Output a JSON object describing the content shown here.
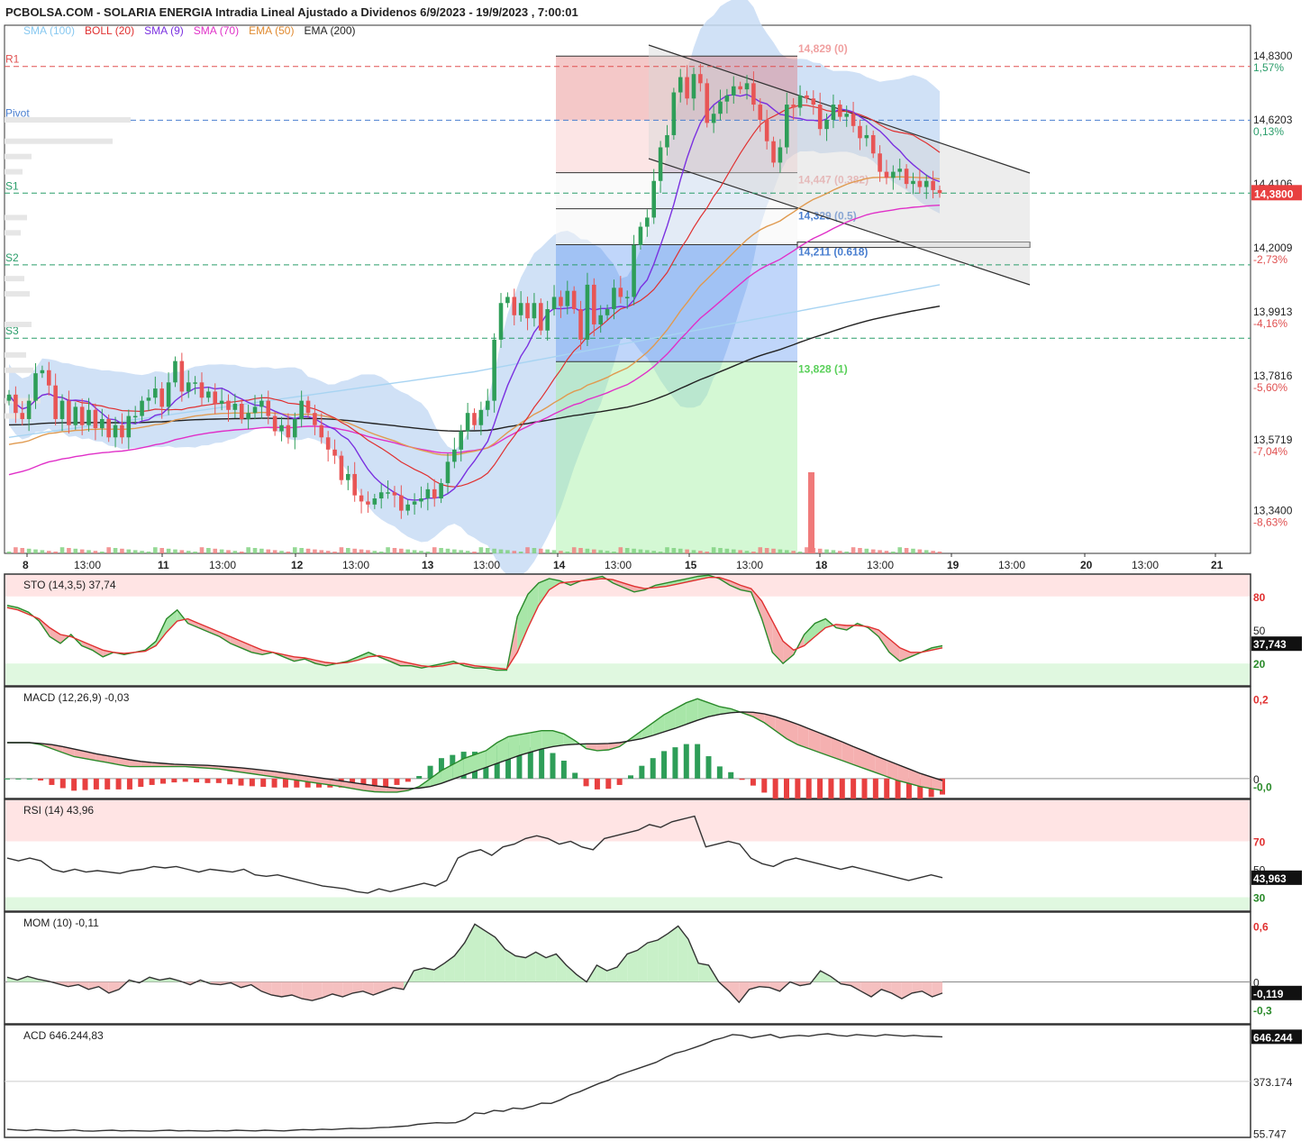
{
  "header": {
    "title": "PCBOLSA.COM - SOLARIA ENERGIA Intradia Lineal Ajustado a Dividenos 6/9/2023 - 19/9/2023 , 7:00:01",
    "legend": [
      {
        "label": "SMA",
        "param": "(100)",
        "color": "#87c8f0"
      },
      {
        "label": "BOLL",
        "param": "(20)",
        "color": "#e03030"
      },
      {
        "label": "SMA",
        "param": "(9)",
        "color": "#7a30e0"
      },
      {
        "label": "SMA",
        "param": "(70)",
        "color": "#e030c8"
      },
      {
        "label": "EMA",
        "param": "(50)",
        "color": "#e08a30"
      },
      {
        "label": "EMA",
        "param": "(200)",
        "color": "#222222"
      }
    ]
  },
  "chart_data": [
    {
      "type": "candlestick",
      "name": "price",
      "y_ticks": [
        {
          "v": 14.83,
          "label": "14,8300",
          "pct": "1,57%",
          "pct_color": "#2a9d6a"
        },
        {
          "v": 14.6203,
          "label": "14,6203",
          "pct": "0,13%",
          "pct_color": "#2a9d6a"
        },
        {
          "v": 14.4106,
          "label": "14,4106",
          "pct": "",
          "pct_color": ""
        },
        {
          "v": 14.2009,
          "label": "14,2009",
          "pct": "-2,73%",
          "pct_color": "#e05050"
        },
        {
          "v": 13.9913,
          "label": "13,9913",
          "pct": "-4,16%",
          "pct_color": "#e05050"
        },
        {
          "v": 13.7816,
          "label": "13,7816",
          "pct": "-5,60%",
          "pct_color": "#e05050"
        },
        {
          "v": 13.5719,
          "label": "13,5719",
          "pct": "-7,04%",
          "pct_color": "#e05050"
        },
        {
          "v": 13.34,
          "label": "13,3400",
          "pct": "-8,63%",
          "pct_color": "#e05050"
        }
      ],
      "last_price": "14,3800",
      "ylim": [
        13.2,
        14.93
      ],
      "pivots": [
        {
          "name": "R1",
          "v": 14.795,
          "color": "#e05050"
        },
        {
          "name": "Pivot",
          "v": 14.619,
          "color": "#4a7fd0"
        },
        {
          "name": "S1",
          "v": 14.38,
          "color": "#2a9d6a"
        },
        {
          "name": "S2",
          "v": 14.145,
          "color": "#2a9d6a"
        },
        {
          "name": "S3",
          "v": 13.905,
          "color": "#2a9d6a"
        }
      ],
      "fibonacci": [
        {
          "label": "14,829 (0)",
          "v": 14.829,
          "color": "#f0a0a0"
        },
        {
          "label": "14,447 (0.382)",
          "v": 14.447,
          "color": "#f0a0a0"
        },
        {
          "label": "14,329 (0.5)",
          "v": 14.329,
          "color": "#4a7fd0"
        },
        {
          "label": "14,211 (0.618)",
          "v": 14.211,
          "color": "#4a7fd0"
        },
        {
          "label": "13,828 (1)",
          "v": 13.828,
          "color": "#5ad05a"
        }
      ],
      "x_labels": [
        {
          "day": "8",
          "hour": "13:00"
        },
        {
          "day": "11",
          "hour": "13:00"
        },
        {
          "day": "12",
          "hour": "13:00"
        },
        {
          "day": "13",
          "hour": "13:00"
        },
        {
          "day": "14",
          "hour": "13:00"
        },
        {
          "day": "15",
          "hour": "13:00"
        },
        {
          "day": "18",
          "hour": "13:00"
        },
        {
          "day": "19",
          "hour": "13:00"
        },
        {
          "day": "20",
          "hour": "13:00"
        },
        {
          "day": "21",
          "hour": ""
        }
      ],
      "close": [
        13.72,
        13.66,
        13.64,
        13.7,
        13.79,
        13.8,
        13.75,
        13.64,
        13.7,
        13.62,
        13.68,
        13.62,
        13.67,
        13.61,
        13.64,
        13.58,
        13.62,
        13.58,
        13.65,
        13.65,
        13.7,
        13.71,
        13.74,
        13.68,
        13.76,
        13.83,
        13.73,
        13.76,
        13.76,
        13.71,
        13.73,
        13.69,
        13.7,
        13.67,
        13.69,
        13.64,
        13.66,
        13.68,
        13.7,
        13.65,
        13.6,
        13.62,
        13.58,
        13.64,
        13.7,
        13.66,
        13.62,
        13.58,
        13.54,
        13.52,
        13.44,
        13.46,
        13.39,
        13.37,
        13.36,
        13.38,
        13.4,
        13.4,
        13.39,
        13.34,
        13.36,
        13.37,
        13.38,
        13.41,
        13.38,
        13.43,
        13.5,
        13.54,
        13.6,
        13.66,
        13.62,
        13.67,
        13.7,
        13.9,
        14.02,
        14.04,
        13.98,
        14.02,
        13.97,
        14.02,
        13.93,
        14.0,
        14.04,
        14.01,
        14.06,
        14.0,
        13.9,
        14.08,
        13.95,
        13.98,
        14.0,
        14.07,
        14.04,
        14.04,
        14.21,
        14.27,
        14.3,
        14.42,
        14.53,
        14.57,
        14.71,
        14.76,
        14.69,
        14.77,
        14.74,
        14.61,
        14.64,
        14.68,
        14.7,
        14.73,
        14.72,
        14.74,
        14.67,
        14.62,
        14.55,
        14.48,
        14.53,
        14.67,
        14.66,
        14.7,
        14.69,
        14.67,
        14.59,
        14.62,
        14.67,
        14.63,
        14.64,
        14.6,
        14.56,
        14.57,
        14.51,
        14.45,
        14.43,
        14.45,
        14.46,
        14.41,
        14.42,
        14.4,
        14.42,
        14.39,
        14.38
      ]
    },
    {
      "type": "line",
      "name": "sto",
      "label": "STO (14,3,5)",
      "value": "37,74",
      "last": "37,743",
      "ylim": [
        0,
        100
      ],
      "ticks": [
        {
          "v": 80,
          "label": "80",
          "color": "#e03030"
        },
        {
          "v": 50,
          "label": "50",
          "color": "#222222"
        },
        {
          "v": 20,
          "label": "20",
          "color": "#2a8a2a"
        }
      ],
      "bands": [
        80,
        20
      ],
      "k": [
        72,
        70,
        66,
        58,
        44,
        38,
        46,
        36,
        32,
        26,
        30,
        28,
        30,
        32,
        40,
        60,
        68,
        56,
        52,
        48,
        44,
        38,
        34,
        30,
        28,
        30,
        26,
        22,
        24,
        20,
        18,
        20,
        22,
        26,
        30,
        26,
        22,
        18,
        18,
        16,
        18,
        20,
        22,
        18,
        16,
        16,
        14,
        14,
        62,
        82,
        92,
        96,
        94,
        90,
        94,
        96,
        98,
        92,
        88,
        84,
        86,
        90,
        92,
        94,
        96,
        98,
        99,
        96,
        90,
        86,
        84,
        60,
        30,
        20,
        28,
        46,
        56,
        60,
        52,
        50,
        56,
        52,
        44,
        30,
        22,
        26,
        30,
        34,
        36
      ],
      "d": [
        70,
        68,
        64,
        60,
        52,
        46,
        44,
        40,
        36,
        32,
        30,
        29,
        30,
        31,
        36,
        48,
        58,
        60,
        56,
        52,
        48,
        44,
        40,
        36,
        32,
        30,
        28,
        26,
        25,
        23,
        21,
        20,
        21,
        23,
        26,
        27,
        25,
        22,
        20,
        18,
        17,
        18,
        20,
        20,
        18,
        17,
        16,
        15,
        30,
        52,
        72,
        86,
        92,
        93,
        94,
        95,
        96,
        95,
        92,
        89,
        87,
        88,
        89,
        91,
        93,
        95,
        97,
        97,
        94,
        90,
        87,
        76,
        58,
        40,
        32,
        36,
        44,
        52,
        55,
        54,
        54,
        53,
        50,
        42,
        34,
        30,
        30,
        32,
        34
      ]
    },
    {
      "type": "line",
      "name": "macd",
      "label": "MACD (12,26,9)",
      "value": "-0,03",
      "ticks": [
        {
          "v": 0.2,
          "label": "0,2",
          "color": "#e03030"
        },
        {
          "v": 0,
          "label": "0",
          "color": "#222222"
        },
        {
          "v": -0.02,
          "label": "-0,0",
          "color": "#2a8a2a"
        }
      ],
      "ylim": [
        -0.05,
        0.23
      ],
      "macd": [
        0.09,
        0.09,
        0.09,
        0.085,
        0.075,
        0.065,
        0.055,
        0.05,
        0.045,
        0.04,
        0.035,
        0.03,
        0.03,
        0.03,
        0.03,
        0.03,
        0.03,
        0.028,
        0.026,
        0.024,
        0.02,
        0.016,
        0.012,
        0.008,
        0.004,
        0.0,
        -0.004,
        -0.008,
        -0.012,
        -0.016,
        -0.02,
        -0.025,
        -0.03,
        -0.033,
        -0.034,
        -0.034,
        -0.03,
        -0.02,
        0.0,
        0.02,
        0.035,
        0.05,
        0.06,
        0.07,
        0.09,
        0.105,
        0.11,
        0.115,
        0.12,
        0.12,
        0.112,
        0.095,
        0.075,
        0.07,
        0.072,
        0.08,
        0.1,
        0.12,
        0.14,
        0.16,
        0.175,
        0.19,
        0.2,
        0.19,
        0.18,
        0.175,
        0.165,
        0.155,
        0.14,
        0.12,
        0.1,
        0.085,
        0.075,
        0.065,
        0.055,
        0.045,
        0.035,
        0.025,
        0.015,
        0.005,
        -0.005,
        -0.012,
        -0.02,
        -0.025,
        -0.03
      ],
      "signal": [
        0.09,
        0.09,
        0.09,
        0.088,
        0.085,
        0.08,
        0.074,
        0.068,
        0.062,
        0.057,
        0.052,
        0.047,
        0.043,
        0.04,
        0.038,
        0.036,
        0.035,
        0.034,
        0.033,
        0.031,
        0.029,
        0.027,
        0.024,
        0.021,
        0.018,
        0.014,
        0.01,
        0.006,
        0.002,
        -0.002,
        -0.006,
        -0.01,
        -0.014,
        -0.018,
        -0.021,
        -0.024,
        -0.025,
        -0.024,
        -0.02,
        -0.012,
        -0.002,
        0.008,
        0.018,
        0.028,
        0.038,
        0.048,
        0.058,
        0.066,
        0.074,
        0.08,
        0.084,
        0.086,
        0.087,
        0.087,
        0.088,
        0.09,
        0.095,
        0.1,
        0.108,
        0.117,
        0.126,
        0.136,
        0.146,
        0.155,
        0.161,
        0.165,
        0.167,
        0.166,
        0.162,
        0.155,
        0.146,
        0.136,
        0.125,
        0.114,
        0.103,
        0.092,
        0.08,
        0.069,
        0.057,
        0.046,
        0.035,
        0.024,
        0.013,
        0.004,
        -0.005
      ]
    },
    {
      "type": "line",
      "name": "rsi",
      "label": "RSI (14)",
      "value": "43,96",
      "last": "43,963",
      "ylim": [
        20,
        100
      ],
      "ticks": [
        {
          "v": 70,
          "label": "70",
          "color": "#e03030"
        },
        {
          "v": 50,
          "label": "50",
          "color": "#222222"
        },
        {
          "v": 30,
          "label": "30",
          "color": "#2a8a2a"
        }
      ],
      "bands": [
        70,
        30
      ],
      "values": [
        58,
        56,
        58,
        56,
        50,
        48,
        50,
        48,
        49,
        48,
        47,
        49,
        50,
        52,
        51,
        52,
        50,
        48,
        50,
        49,
        48,
        50,
        46,
        45,
        46,
        44,
        42,
        40,
        38,
        37,
        36,
        34,
        33,
        36,
        34,
        36,
        38,
        40,
        38,
        42,
        58,
        62,
        64,
        60,
        66,
        68,
        72,
        74,
        72,
        68,
        70,
        66,
        64,
        72,
        74,
        76,
        78,
        82,
        80,
        84,
        86,
        88,
        66,
        68,
        70,
        68,
        58,
        54,
        52,
        56,
        58,
        56,
        54,
        52,
        50,
        52,
        50,
        48,
        46,
        44,
        42,
        44,
        46,
        44
      ]
    },
    {
      "type": "line",
      "name": "mom",
      "label": "MOM (10)",
      "value": "-0,11",
      "last": "-0,119",
      "ylim": [
        -0.45,
        0.75
      ],
      "ticks": [
        {
          "v": 0.6,
          "label": "0,6",
          "color": "#e03030"
        },
        {
          "v": 0,
          "label": "0",
          "color": "#222222"
        },
        {
          "v": -0.3,
          "label": "-0,3",
          "color": "#2a8a2a"
        }
      ],
      "values": [
        0.05,
        0.02,
        0.06,
        0.03,
        0.01,
        -0.02,
        -0.05,
        -0.03,
        -0.08,
        -0.05,
        -0.12,
        -0.08,
        0.02,
        -0.01,
        0.05,
        0.02,
        0.04,
        0.01,
        -0.03,
        0.02,
        -0.02,
        -0.03,
        -0.01,
        -0.06,
        -0.03,
        -0.1,
        -0.14,
        -0.16,
        -0.14,
        -0.18,
        -0.2,
        -0.17,
        -0.13,
        -0.16,
        -0.12,
        -0.1,
        -0.14,
        -0.1,
        -0.06,
        -0.08,
        0.12,
        0.15,
        0.13,
        0.2,
        0.28,
        0.42,
        0.62,
        0.55,
        0.48,
        0.35,
        0.28,
        0.26,
        0.32,
        0.26,
        0.3,
        0.18,
        0.08,
        0.0,
        0.18,
        0.12,
        0.16,
        0.3,
        0.34,
        0.42,
        0.45,
        0.52,
        0.6,
        0.46,
        0.2,
        0.18,
        0.0,
        -0.1,
        -0.22,
        -0.08,
        -0.05,
        -0.06,
        -0.1,
        0.0,
        -0.04,
        -0.02,
        0.12,
        0.06,
        -0.02,
        -0.04,
        -0.1,
        -0.16,
        -0.08,
        -0.12,
        -0.18,
        -0.12,
        -0.1,
        -0.16,
        -0.12
      ]
    },
    {
      "type": "line",
      "name": "acd",
      "label": "ACD",
      "value": "646.244,83",
      "last": "646.244",
      "ylim": [
        30,
        720
      ],
      "ticks": [
        {
          "v": 373.174,
          "label": "373.174",
          "color": "#222222"
        },
        {
          "v": 55.747,
          "label": "55.747",
          "color": "#222222"
        }
      ],
      "values": [
        80,
        75,
        72,
        78,
        74,
        70,
        72,
        76,
        70,
        68,
        72,
        74,
        70,
        72,
        70,
        68,
        72,
        74,
        70,
        72,
        70,
        68,
        72,
        70,
        74,
        72,
        70,
        74,
        72,
        70,
        74,
        78,
        76,
        80,
        78,
        82,
        86,
        84,
        86,
        90,
        92,
        96,
        100,
        110,
        115,
        120,
        118,
        120,
        140,
        180,
        175,
        195,
        190,
        210,
        205,
        220,
        240,
        238,
        260,
        290,
        310,
        335,
        360,
        380,
        410,
        430,
        450,
        470,
        490,
        520,
        545,
        560,
        580,
        600,
        625,
        640,
        660,
        655,
        640,
        650,
        660,
        640,
        650,
        655,
        650,
        660,
        665,
        655,
        650,
        660,
        655,
        650,
        660,
        655,
        650,
        655,
        650,
        648,
        646
      ]
    }
  ]
}
